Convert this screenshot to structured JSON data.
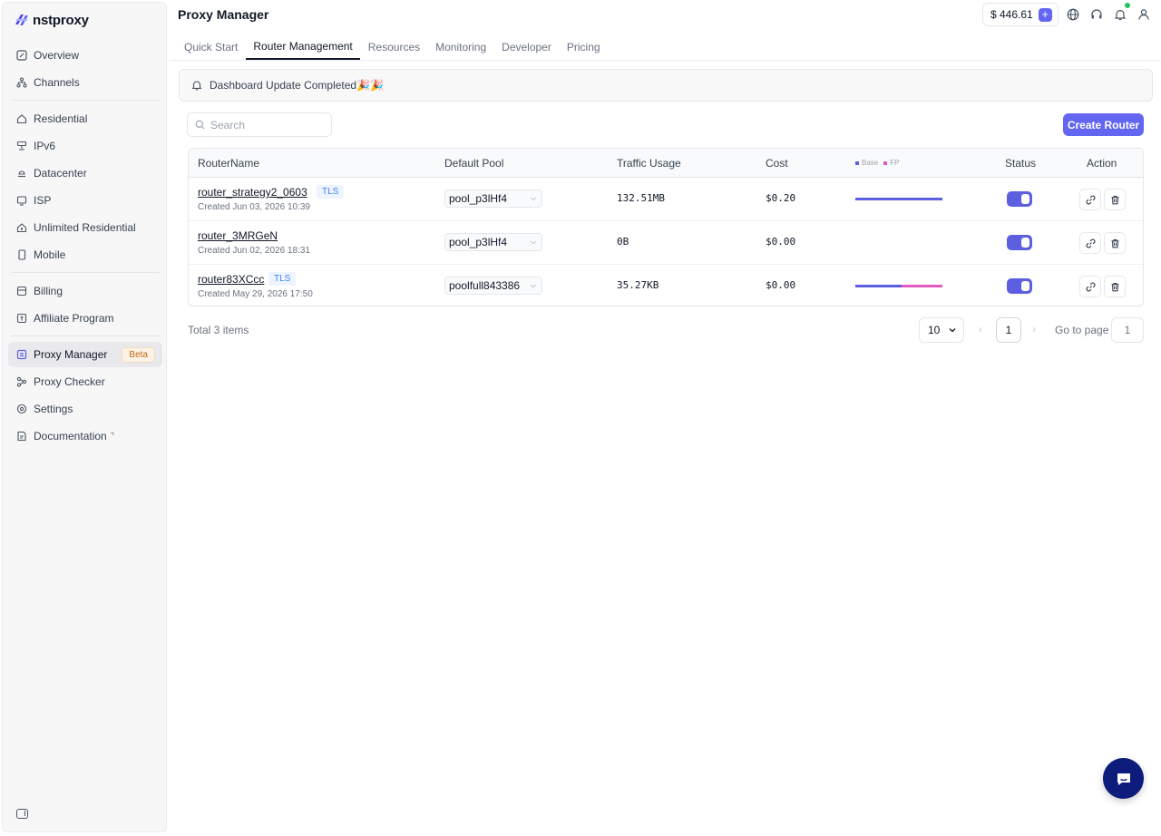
{
  "brand": {
    "name": "nstproxy",
    "color": "#5b5fe0"
  },
  "sidebar": {
    "group1": [
      {
        "label": "Overview",
        "icon": "overview-icon"
      },
      {
        "label": "Channels",
        "icon": "channels-icon"
      }
    ],
    "group2": [
      {
        "label": "Residential",
        "icon": "residential-icon"
      },
      {
        "label": "IPv6",
        "icon": "ipv6-icon"
      },
      {
        "label": "Datacenter",
        "icon": "datacenter-icon"
      },
      {
        "label": "ISP",
        "icon": "isp-icon"
      },
      {
        "label": "Unlimited Residential",
        "icon": "unlimited-residential-icon"
      },
      {
        "label": "Mobile",
        "icon": "mobile-icon"
      }
    ],
    "group3": [
      {
        "label": "Billing",
        "icon": "billing-icon"
      },
      {
        "label": "Affiliate Program",
        "icon": "affiliate-icon"
      }
    ],
    "group4": [
      {
        "label": "Proxy Manager",
        "icon": "proxy-manager-icon",
        "badge": "Beta",
        "active": true
      },
      {
        "label": "Proxy Checker",
        "icon": "proxy-checker-icon"
      },
      {
        "label": "Settings",
        "icon": "settings-icon"
      },
      {
        "label": "Documentation",
        "icon": "documentation-icon",
        "external": true
      }
    ]
  },
  "header": {
    "title": "Proxy Manager",
    "balance": "$ 446.61",
    "tabs": [
      "Quick Start",
      "Router Management",
      "Resources",
      "Monitoring",
      "Developer",
      "Pricing"
    ],
    "active_tab": "Router Management"
  },
  "notice": {
    "text": "Dashboard Update Completed",
    "emoji": "🎉🎉"
  },
  "search": {
    "placeholder": "Search",
    "value": ""
  },
  "create_button": "Create Router",
  "table": {
    "columns": {
      "name": "RouterName",
      "pool": "Default Pool",
      "traffic": "Traffic Usage",
      "cost": "Cost",
      "legend_base": "Base",
      "legend_fp": "FP",
      "status": "Status",
      "action": "Action"
    },
    "colors": {
      "base": "#5b5fe0",
      "fp": "#e35bbf"
    },
    "rows": [
      {
        "name": "router_strategy2_0603",
        "tls": "TLS",
        "created": "Created Jun 03, 2026 10:39",
        "pool": "pool_p3lHf4",
        "traffic": "132.51MB",
        "cost": "$0.20",
        "base_fraction": 1.0,
        "fp_fraction": 0.0,
        "enabled": true
      },
      {
        "name": "router_3MRGeN",
        "tls": "",
        "created": "Created Jun 02, 2026 18:31",
        "pool": "pool_p3lHf4",
        "traffic": "0B",
        "cost": "$0.00",
        "base_fraction": 0.0,
        "fp_fraction": 0.0,
        "enabled": true
      },
      {
        "name": "router83XCcc",
        "tls": "TLS",
        "created": "Created May 29, 2026 17:50",
        "pool": "poolfull843386",
        "traffic": "35.27KB",
        "cost": "$0.00",
        "base_fraction": 0.53,
        "fp_fraction": 0.47,
        "enabled": true
      }
    ]
  },
  "pagination": {
    "total": "Total 3 items",
    "page_size": "10",
    "current_page": "1",
    "goto_label": "Go to page",
    "goto_placeholder": "1"
  }
}
